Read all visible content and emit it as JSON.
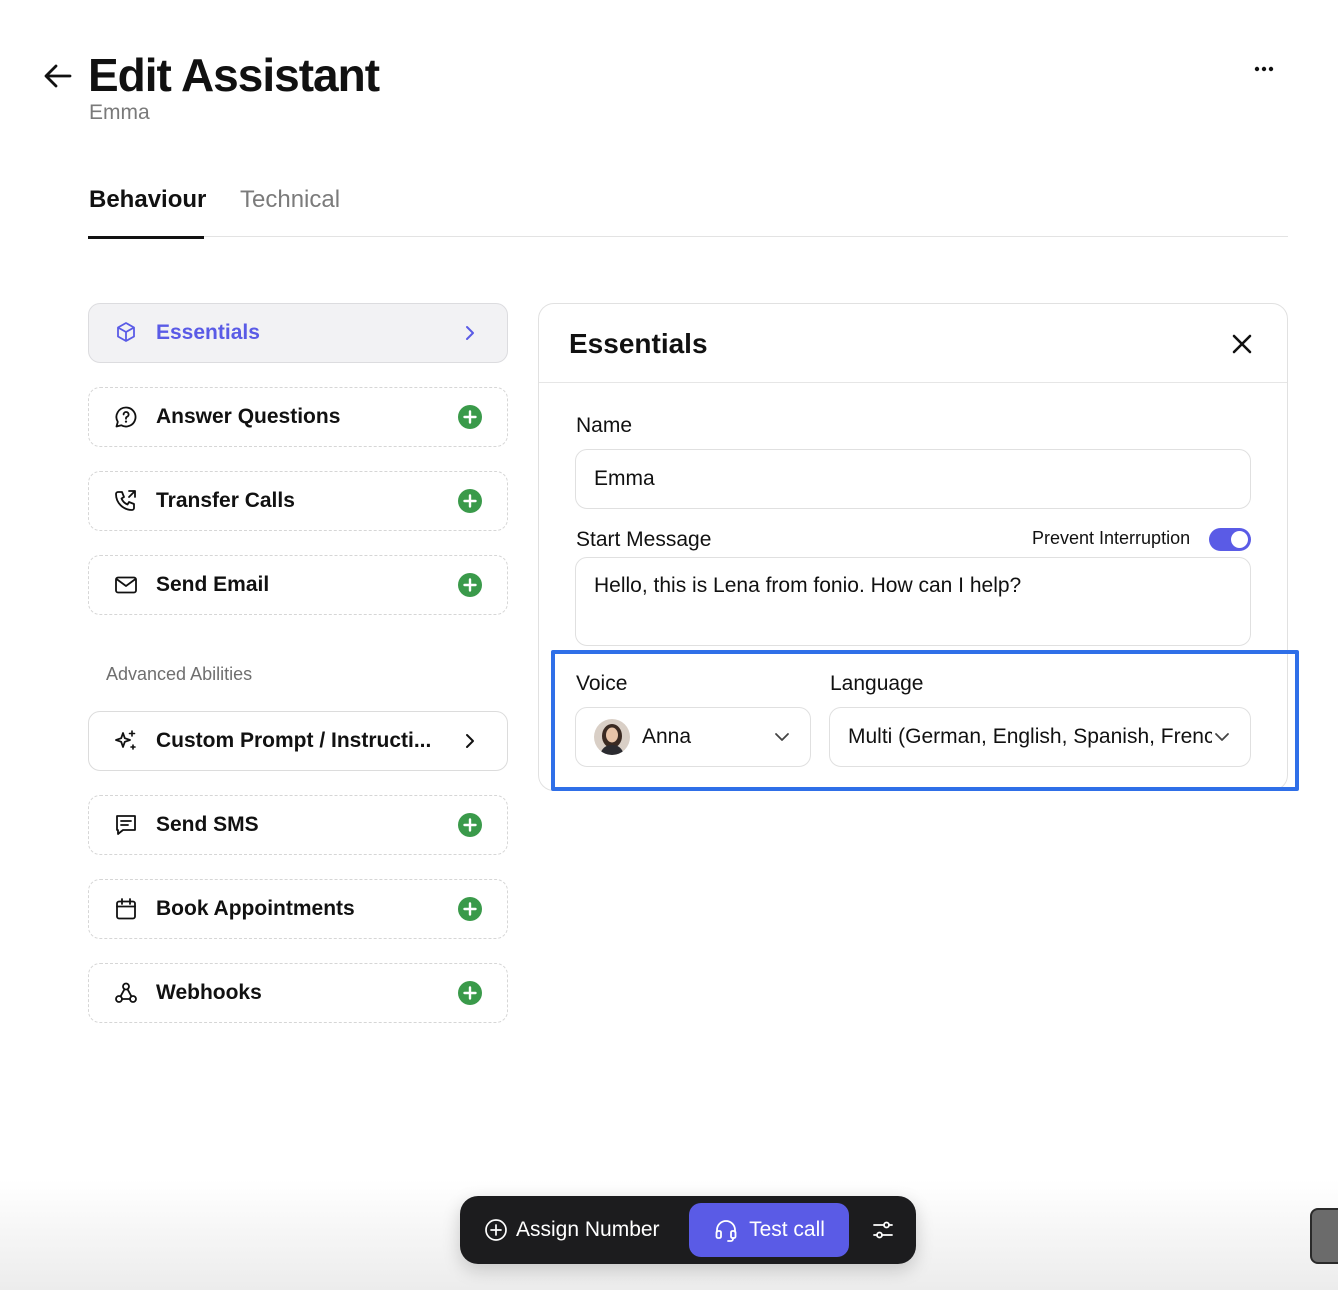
{
  "header": {
    "title": "Edit Assistant",
    "subtitle": "Emma"
  },
  "tabs": [
    {
      "label": "Behaviour",
      "active": true
    },
    {
      "label": "Technical",
      "active": false
    }
  ],
  "abilities": [
    {
      "label": "Essentials",
      "icon": "cube-icon",
      "trailing": "chevron-right-icon",
      "active": true
    },
    {
      "label": "Answer Questions",
      "icon": "chat-question-icon",
      "trailing": "add-circle-icon"
    },
    {
      "label": "Transfer Calls",
      "icon": "phone-transfer-icon",
      "trailing": "add-circle-icon"
    },
    {
      "label": "Send Email",
      "icon": "mail-icon",
      "trailing": "add-circle-icon"
    }
  ],
  "advanced": {
    "section_label": "Advanced Abilities",
    "items": [
      {
        "label": "Custom Prompt / Instructi...",
        "icon": "sparkle-icon",
        "trailing": "chevron-right-icon"
      },
      {
        "label": "Send SMS",
        "icon": "message-icon",
        "trailing": "add-circle-icon"
      },
      {
        "label": "Book Appointments",
        "icon": "calendar-icon",
        "trailing": "add-circle-icon"
      },
      {
        "label": "Webhooks",
        "icon": "webhook-icon",
        "trailing": "add-circle-icon"
      }
    ]
  },
  "panel": {
    "title": "Essentials",
    "name_label": "Name",
    "name_value": "Emma",
    "start_message_label": "Start Message",
    "prevent_interruption_label": "Prevent Interruption",
    "prevent_interruption_on": true,
    "start_message_value": "Hello, this is Lena from fonio. How can I help?",
    "voice_label": "Voice",
    "voice_value": "Anna",
    "language_label": "Language",
    "language_value": "Multi (German, English, Spanish, French"
  },
  "bottom_bar": {
    "assign_label": "Assign Number",
    "test_label": "Test call"
  },
  "colors": {
    "accent": "#5a5be6",
    "add_green": "#3a9a4a",
    "highlight": "#2f6fe8",
    "bar_bg": "#1c1c1e"
  }
}
